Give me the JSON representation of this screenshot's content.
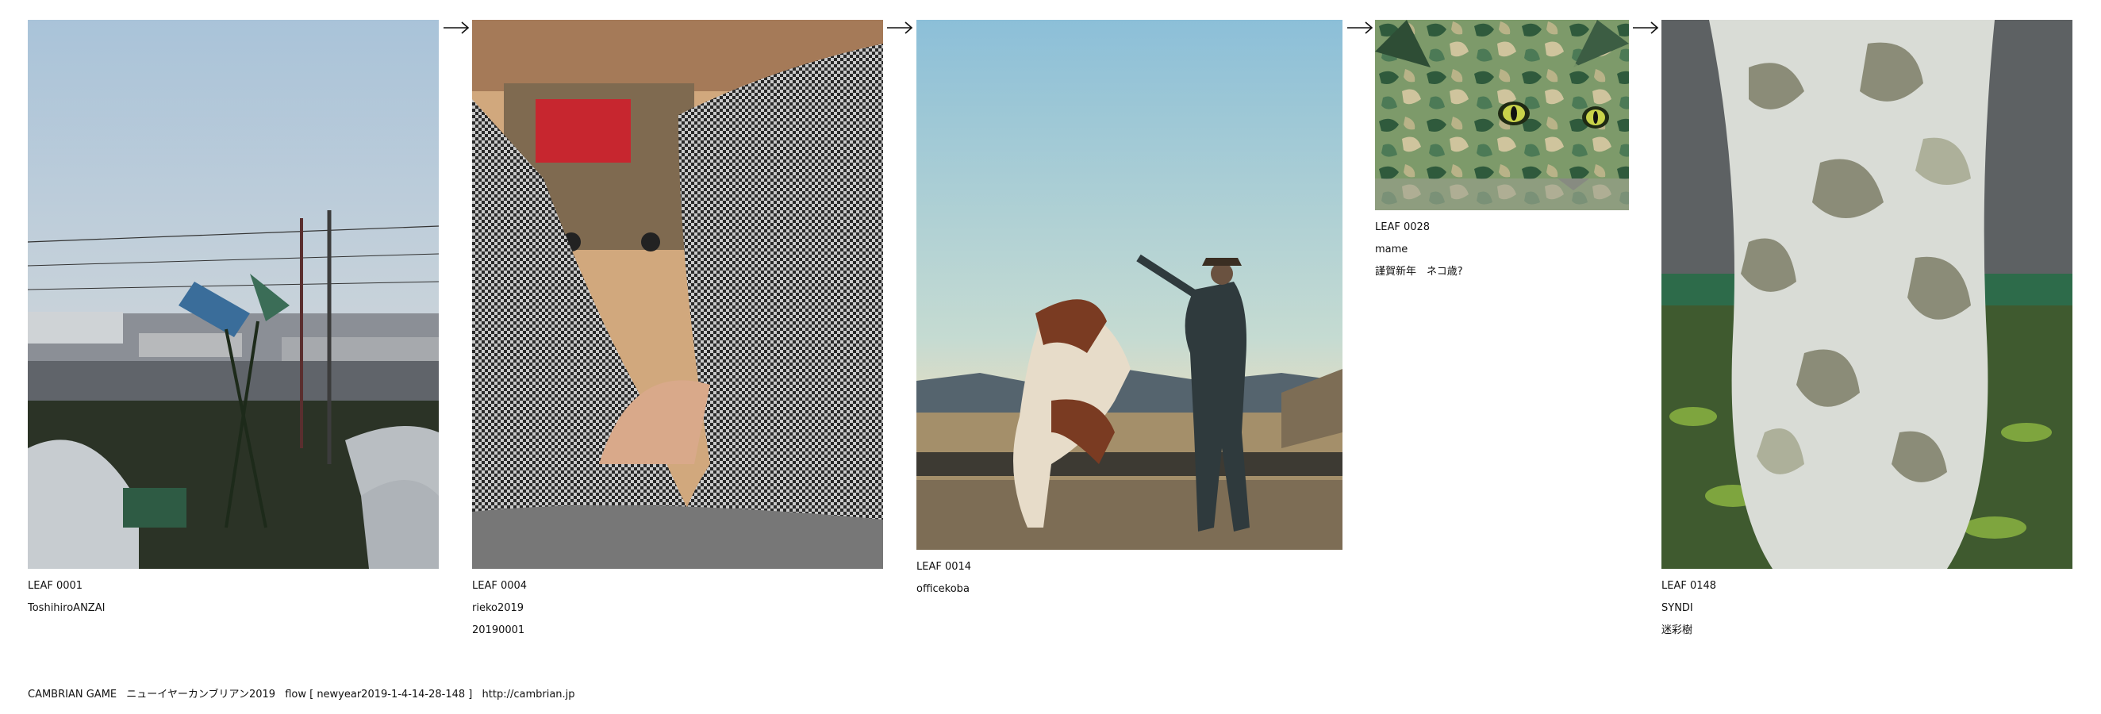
{
  "leaves": [
    {
      "id": "LEAF 0001",
      "lines": [
        "ToshihiroANZAI"
      ]
    },
    {
      "id": "LEAF 0004",
      "lines": [
        "rieko2019",
        "20190001"
      ]
    },
    {
      "id": "LEAF 0014",
      "lines": [
        "officekoba"
      ]
    },
    {
      "id": "LEAF 0028",
      "lines": [
        "mame",
        "謹賀新年　ネコ歳?"
      ]
    },
    {
      "id": "LEAF 0148",
      "lines": [
        "SYNDI",
        "迷彩樹"
      ]
    }
  ],
  "footer": {
    "site": "CAMBRIAN GAME",
    "title": "ニューイヤーカンブリアン2019",
    "flow": "flow [ newyear2019-1-4-14-28-148 ]",
    "url": "http://cambrian.jp"
  }
}
